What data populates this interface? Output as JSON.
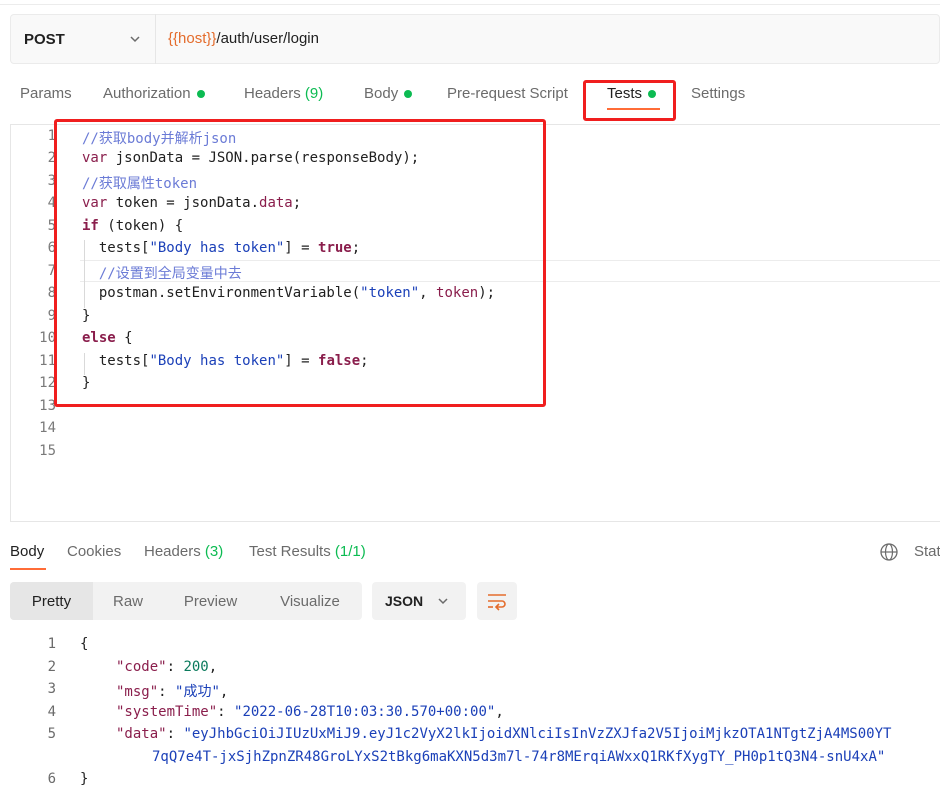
{
  "request": {
    "method": "POST",
    "url_var": "{{host}}",
    "url_path": "/auth/user/login"
  },
  "tabs": [
    {
      "label": "Params",
      "dot": false
    },
    {
      "label": "Authorization",
      "dot": true
    },
    {
      "label": "Headers",
      "count": "(9)",
      "dot": false
    },
    {
      "label": "Body",
      "dot": true
    },
    {
      "label": "Pre-request Script",
      "dot": false
    },
    {
      "label": "Tests",
      "dot": true,
      "active": true
    },
    {
      "label": "Settings",
      "dot": false
    }
  ],
  "editor": {
    "line_numbers": [
      "1",
      "2",
      "3",
      "4",
      "5",
      "6",
      "7",
      "8",
      "9",
      "10",
      "11",
      "12",
      "13",
      "14",
      "15"
    ],
    "lines": [
      "//获取body并解析json",
      "var jsonData = JSON.parse(responseBody);",
      "//获取属性token",
      "var token = jsonData.data;",
      "if (token) {",
      "  tests[\"Body has token\"] = true;",
      "  //设置到全局变量中去",
      "  postman.setEnvironmentVariable(\"token\", token);",
      "}",
      "else {",
      "  tests[\"Body has token\"] = false;",
      "}",
      "",
      "",
      ""
    ]
  },
  "response": {
    "tabs": [
      {
        "label": "Body",
        "active": true
      },
      {
        "label": "Cookies"
      },
      {
        "label": "Headers",
        "count": "(3)"
      },
      {
        "label": "Test Results",
        "count": "(1/1)"
      }
    ],
    "status_partial": "Stat",
    "view_modes": [
      "Pretty",
      "Raw",
      "Preview",
      "Visualize"
    ],
    "selected_view": "Pretty",
    "format": "JSON",
    "line_numbers": [
      "1",
      "2",
      "3",
      "4",
      "5",
      "6"
    ],
    "body": {
      "open": "{",
      "code_key": "\"code\"",
      "code_val": "200",
      "msg_key": "\"msg\"",
      "msg_val": "\"成功\"",
      "time_key": "\"systemTime\"",
      "time_val": "\"2022-06-28T10:03:30.570+00:00\"",
      "data_key": "\"data\"",
      "data_val_1": "\"eyJhbGciOiJIUzUxMiJ9.eyJ1c2VyX2lkIjoidXNlciIsInVzZXJfa2V5IjoiMjkzOTA1NTgtZjA4MS00YT",
      "data_val_2": "7qQ7e4T-jxSjhZpnZR48GroLYxS2tBkg6maKXN5d3m7l-74r8MErqiAWxxQ1RKfXygTY_PH0p1tQ3N4-snU4xA\""
    }
  }
}
